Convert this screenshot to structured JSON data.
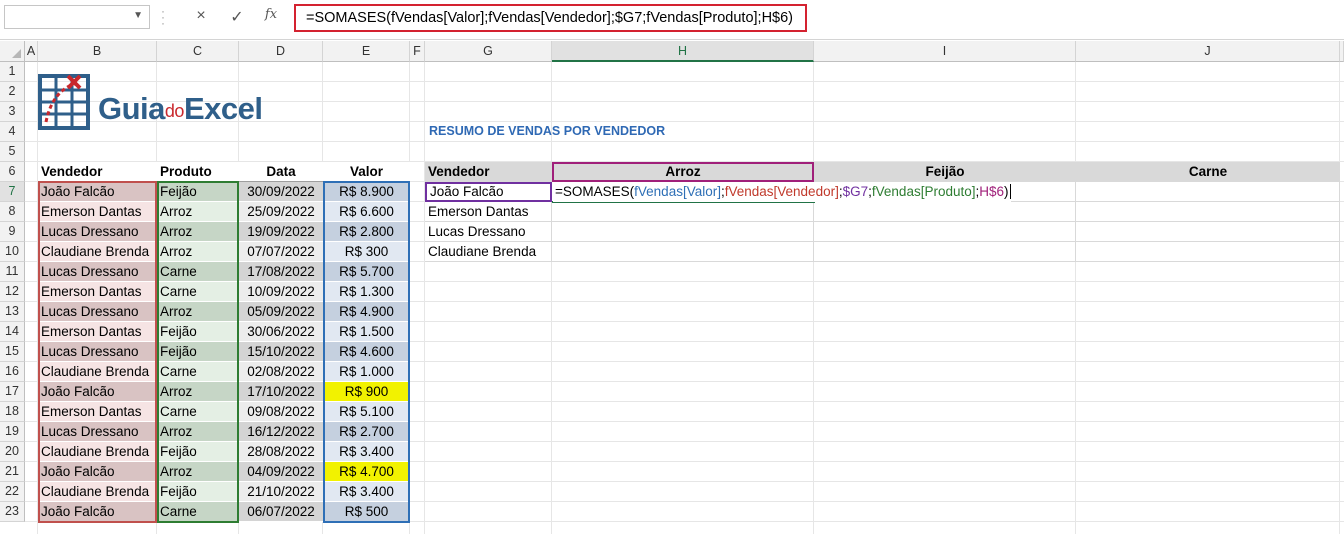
{
  "formula_bar": {
    "name_box_value": "",
    "cancel_icon": "×",
    "enter_icon": "✓",
    "fx_icon": "fx",
    "formula": "=SOMASES(fVendas[Valor];fVendas[Vendedor];$G7;fVendas[Produto];H$6)"
  },
  "columns": [
    "A",
    "B",
    "C",
    "D",
    "E",
    "F",
    "G",
    "H",
    "I",
    "J"
  ],
  "rows": [
    "1",
    "2",
    "3",
    "4",
    "5",
    "6",
    "7",
    "8",
    "9",
    "10",
    "11",
    "12",
    "13",
    "14",
    "15",
    "16",
    "17",
    "18",
    "19",
    "20",
    "21",
    "22",
    "23"
  ],
  "logo": {
    "part1": "Guia",
    "part2": "do",
    "part3": "Excel"
  },
  "sales_table": {
    "headers": [
      "Vendedor",
      "Produto",
      "Data",
      "Valor"
    ],
    "rows": [
      [
        "João Falcão",
        "Feijão",
        "30/09/2022",
        "R$ 8.900"
      ],
      [
        "Emerson Dantas",
        "Arroz",
        "25/09/2022",
        "R$ 6.600"
      ],
      [
        "Lucas Dressano",
        "Arroz",
        "19/09/2022",
        "R$ 2.800"
      ],
      [
        "Claudiane Brenda",
        "Arroz",
        "07/07/2022",
        "R$ 300"
      ],
      [
        "Lucas Dressano",
        "Carne",
        "17/08/2022",
        "R$ 5.700"
      ],
      [
        "Emerson Dantas",
        "Carne",
        "10/09/2022",
        "R$ 1.300"
      ],
      [
        "Lucas Dressano",
        "Arroz",
        "05/09/2022",
        "R$ 4.900"
      ],
      [
        "Emerson Dantas",
        "Feijão",
        "30/06/2022",
        "R$ 1.500"
      ],
      [
        "Lucas Dressano",
        "Feijão",
        "15/10/2022",
        "R$ 4.600"
      ],
      [
        "Claudiane Brenda",
        "Carne",
        "02/08/2022",
        "R$ 1.000"
      ],
      [
        "João Falcão",
        "Arroz",
        "17/10/2022",
        "R$ 900"
      ],
      [
        "Emerson Dantas",
        "Carne",
        "09/08/2022",
        "R$ 5.100"
      ],
      [
        "Lucas Dressano",
        "Arroz",
        "16/12/2022",
        "R$ 2.700"
      ],
      [
        "Claudiane Brenda",
        "Feijão",
        "28/08/2022",
        "R$ 3.400"
      ],
      [
        "João Falcão",
        "Arroz",
        "04/09/2022",
        "R$ 4.700"
      ],
      [
        "Claudiane Brenda",
        "Feijão",
        "21/10/2022",
        "R$ 3.400"
      ],
      [
        "João Falcão",
        "Carne",
        "06/07/2022",
        "R$ 500"
      ]
    ],
    "highlighted_rows": [
      10,
      14
    ]
  },
  "summary": {
    "title": "RESUMO DE VENDAS POR VENDEDOR",
    "headers": [
      "Vendedor",
      "Arroz",
      "Feijão",
      "Carne"
    ],
    "sellers": [
      "João Falcão",
      "Emerson Dantas",
      "Lucas Dressano",
      "Claudiane Brenda"
    ],
    "active_formula_parts": [
      {
        "t": "=SOMASES(",
        "c": ""
      },
      {
        "t": "fVendas[Valor]",
        "c": "f-blue"
      },
      {
        "t": ";",
        "c": ""
      },
      {
        "t": "fVendas[Vendedor]",
        "c": "f-red"
      },
      {
        "t": ";",
        "c": ""
      },
      {
        "t": "$G7",
        "c": "f-purple"
      },
      {
        "t": ";",
        "c": ""
      },
      {
        "t": "fVendas[Produto]",
        "c": "f-green"
      },
      {
        "t": ";",
        "c": ""
      },
      {
        "t": "H$6",
        "c": "f-mag"
      },
      {
        "t": ")",
        "c": ""
      }
    ]
  },
  "colors": {
    "vendor_box": "#c0504d",
    "product_box": "#2e7d32",
    "value_box": "#2e6fb6",
    "highlight": "#f2f200",
    "header_gray": "#d9d9d9"
  }
}
